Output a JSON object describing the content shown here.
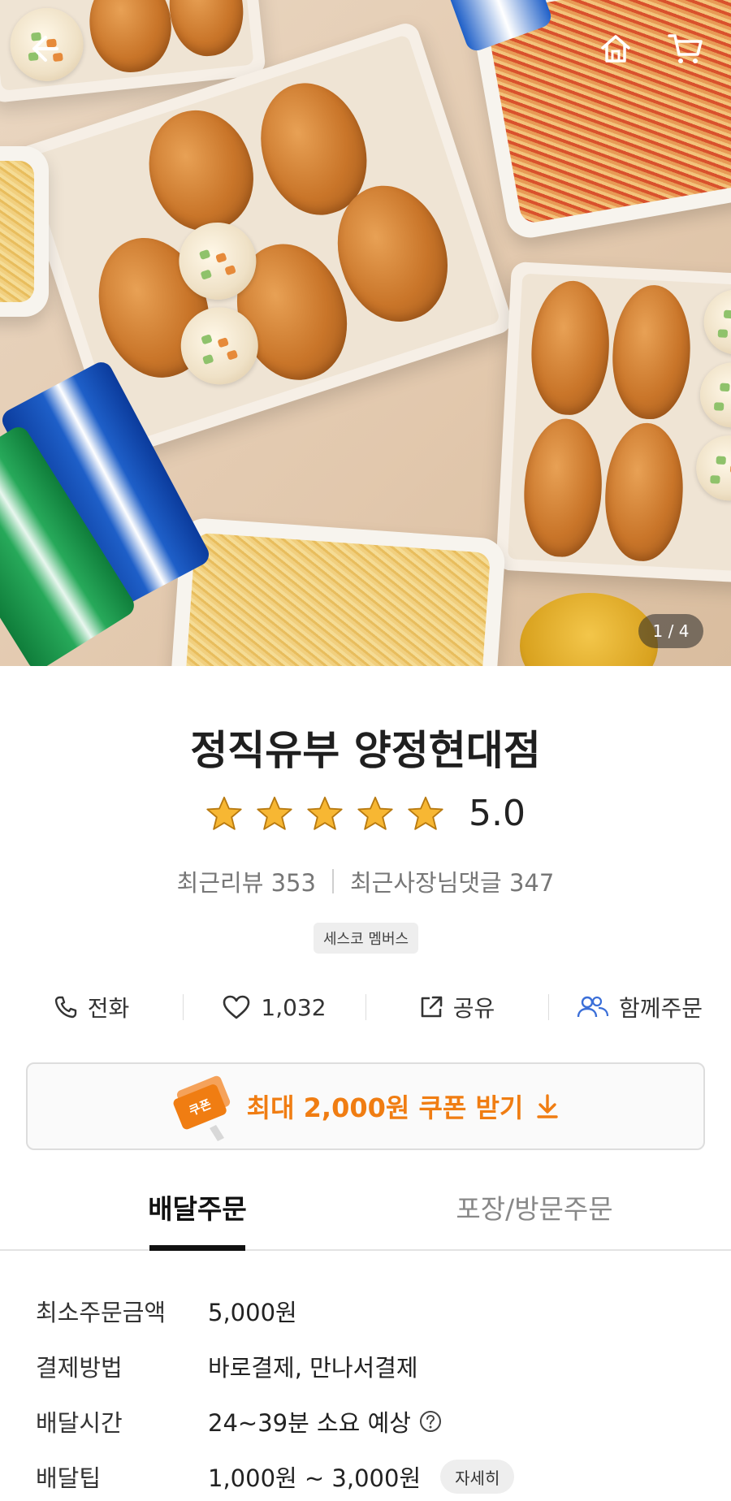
{
  "hero": {
    "page_indicator": "1 / 4",
    "back_icon": "arrow-left-icon",
    "home_icon": "home-icon",
    "cart_icon": "cart-icon"
  },
  "store": {
    "name": "정직유부 양정현대점",
    "rating": "5.0",
    "stars": 5,
    "recent_reviews": "최근리뷰 353",
    "recent_owner_replies": "최근사장님댓글 347",
    "badge": "세스코 멤버스"
  },
  "actions": {
    "call": "전화",
    "likes": "1,032",
    "share": "공유",
    "group_order": "함께주문"
  },
  "coupon": {
    "icon_label": "쿠폰",
    "text": "최대 2,000원 쿠폰 받기"
  },
  "tabs": {
    "delivery": "배달주문",
    "pickup": "포장/방문주문"
  },
  "info": {
    "min_order_label": "최소주문금액",
    "min_order_value": "5,000원",
    "payment_label": "결제방법",
    "payment_value": "바로결제, 만나서결제",
    "time_label": "배달시간",
    "time_value": "24~39분 소요 예상",
    "tip_label": "배달팁",
    "tip_value": "1,000원 ~ 3,000원",
    "detail_button": "자세히"
  },
  "colors": {
    "accent_orange": "#f07d12",
    "star_yellow": "#f7b733",
    "group_icon_blue": "#3b6fd8"
  }
}
